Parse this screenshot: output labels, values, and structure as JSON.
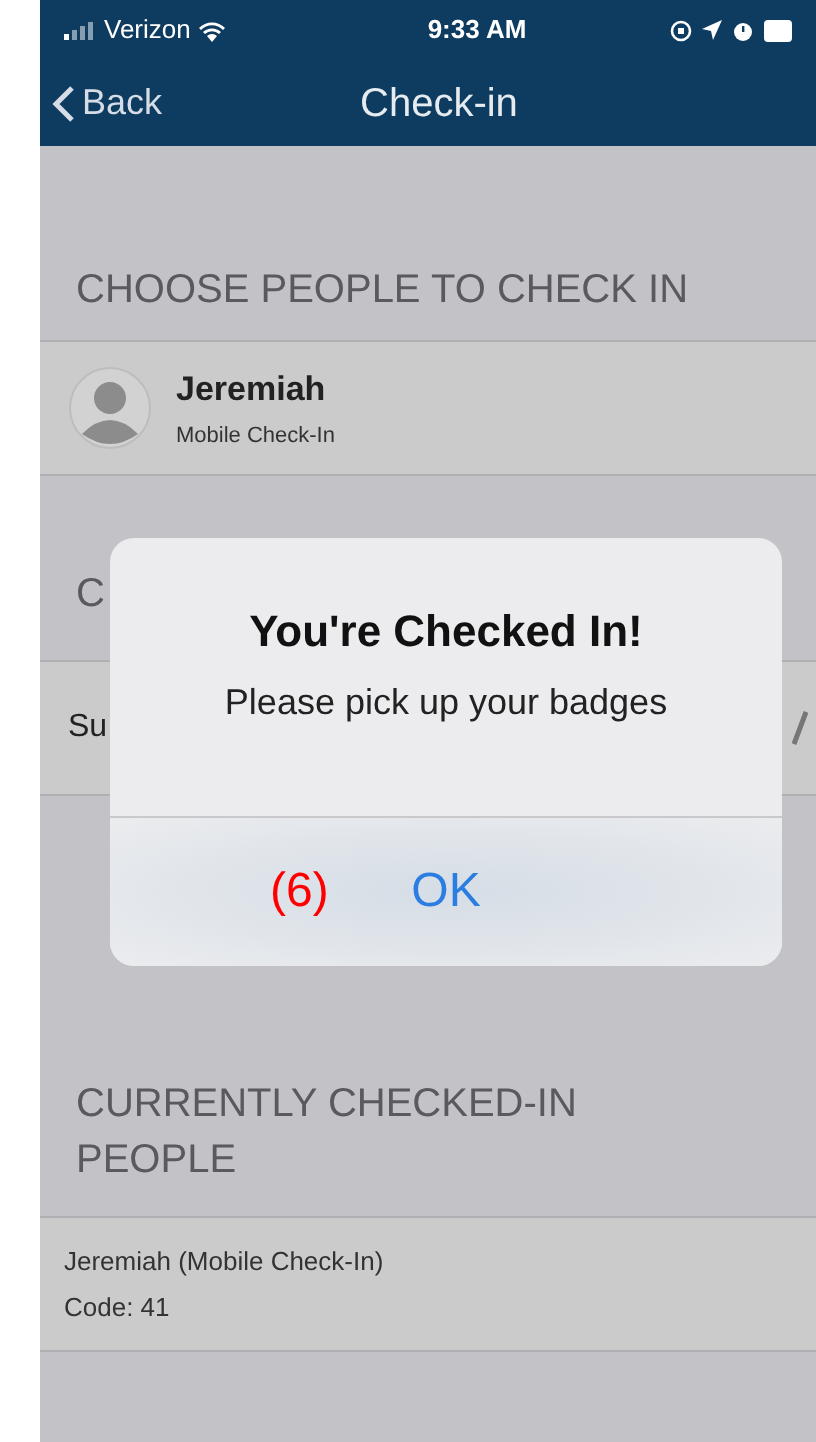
{
  "status_bar": {
    "carrier": "Verizon",
    "time": "9:33 AM"
  },
  "nav": {
    "back": "Back",
    "title": "Check-in"
  },
  "sections": [
    {
      "header": "CHOOSE PEOPLE TO CHECK IN",
      "rows": [
        {
          "kind": "person",
          "name": "Jeremiah",
          "subtitle": "Mobile Check-In"
        }
      ]
    },
    {
      "header": "C",
      "rows": [
        {
          "kind": "partial",
          "text": "Su"
        }
      ]
    },
    {
      "header": "CURRENTLY CHECKED-IN PEOPLE",
      "rows": [
        {
          "kind": "checked",
          "name": "Jeremiah (Mobile Check-In)",
          "code": "Code: 41"
        }
      ]
    }
  ],
  "alert": {
    "title": "You're Checked In!",
    "message": "Please pick up your badges",
    "button": "OK",
    "annotation": "(6)"
  }
}
